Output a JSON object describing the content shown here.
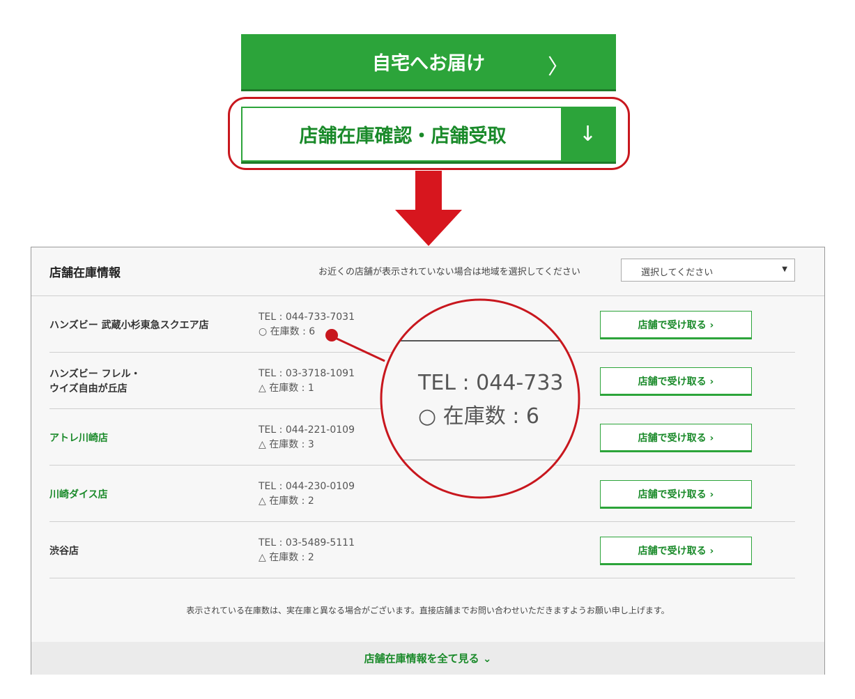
{
  "home_delivery": {
    "label": "自宅へお届け",
    "chevron": "〉"
  },
  "store_check": {
    "label": "店舗在庫確認・店舗受取",
    "arrow": "↓"
  },
  "panel": {
    "title": "店舗在庫情報",
    "hint": "お近くの店舗が表示されていない場合は地域を選択してください",
    "region_select": {
      "value": "選択してください",
      "caret": "▼"
    },
    "stores": [
      {
        "name": "ハンズビー 武蔵小杉東急スクエア店",
        "tel": "TEL : 044-733-7031",
        "stock": "○ 在庫数 : 6",
        "button": "店舗で受け取る ›"
      },
      {
        "name_line1": "ハンズビー フレル・",
        "name_line2": "ウイズ自由が丘店",
        "tel": "TEL : 03-3718-1091",
        "stock": "△ 在庫数 : 1",
        "button": "店舗で受け取る ›"
      },
      {
        "name": "アトレ川崎店",
        "tel": "TEL : 044-221-0109",
        "stock": "△ 在庫数 : 3",
        "button": "店舗で受け取る ›"
      },
      {
        "name": "川崎ダイス店",
        "tel": "TEL : 044-230-0109",
        "stock": "△ 在庫数 : 2",
        "button": "店舗で受け取る ›"
      },
      {
        "name": "渋谷店",
        "tel": "TEL : 03-5489-5111",
        "stock": "△ 在庫数 : 2",
        "button": "店舗で受け取る ›"
      }
    ],
    "notice": "表示されている在庫数は、実在庫と異なる場合がございます。直接店舗までお問い合わせいただきますようお願い申し上げます。",
    "show_all": "店舗在庫情報を全て見る ⌄"
  },
  "magnifier": {
    "tel": "TEL : 044-733",
    "stock": "○ 在庫数 : 6"
  },
  "colors": {
    "green": "#2ca43a",
    "dark_green": "#1a8a2a",
    "red": "#c8171e"
  }
}
